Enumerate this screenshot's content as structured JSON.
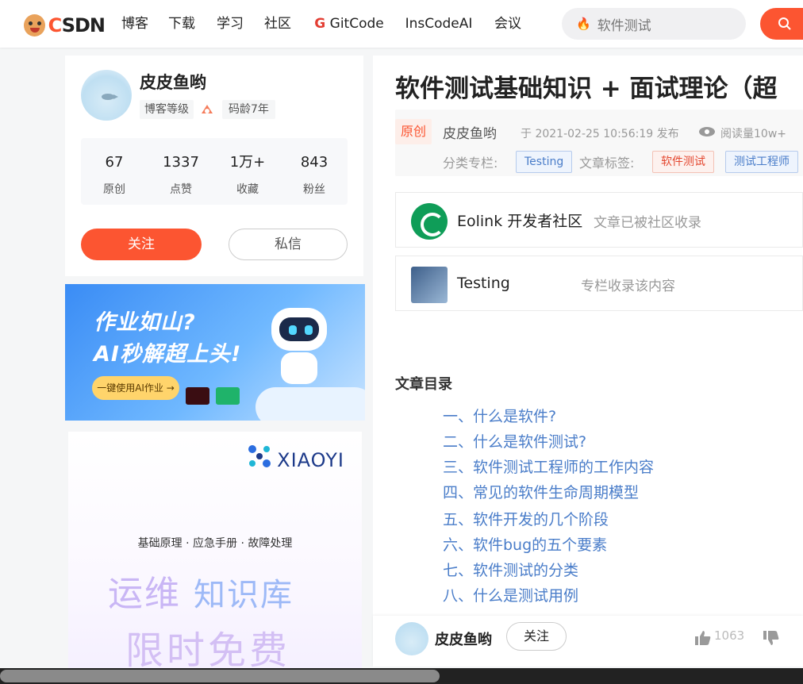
{
  "nav": {
    "brand": "CSDN",
    "items": [
      {
        "label": "博客"
      },
      {
        "label": "下载"
      },
      {
        "label": "学习"
      },
      {
        "label": "社区"
      },
      {
        "label": "GitCode"
      },
      {
        "label": "InsCodeAI"
      },
      {
        "label": "会议"
      }
    ],
    "search_placeholder": "软件测试",
    "accent_color": "#fc5531"
  },
  "profile": {
    "name": "皮皮鱼哟",
    "level_label": "博客等级",
    "code_age": "码龄7年",
    "stats": [
      {
        "value": "67",
        "label": "原创"
      },
      {
        "value": "1337",
        "label": "点赞"
      },
      {
        "value": "1万+",
        "label": "收藏"
      },
      {
        "value": "843",
        "label": "粉丝"
      }
    ],
    "follow_label": "关注",
    "message_label": "私信"
  },
  "ad1": {
    "line1": "作业如山?",
    "line2": "AI秒解超上头!",
    "cta": "一键使用AI作业 →"
  },
  "ad2": {
    "brand": "XIAOYI",
    "subtitle": "基础原理 · 应急手册 · 故障处理",
    "line1a": "运维",
    "line1b": "知识库",
    "line2": "限时免费"
  },
  "article": {
    "title": "软件测试基础知识 + 面试理论（超",
    "original_tag": "原创",
    "author": "皮皮鱼哟",
    "published": "于 2021-02-25 10:56:19 发布",
    "views": "阅读量10w+",
    "category_label": "分类专栏:",
    "category": "Testing",
    "tags_label": "文章标签:",
    "tags": [
      "软件测试",
      "测试工程师"
    ],
    "collections": [
      {
        "title": "Eolink 开发者社区",
        "note": "文章已被社区收录"
      },
      {
        "title": "Testing",
        "note": "专栏收录该内容"
      }
    ],
    "toc_title": "文章目录",
    "toc": [
      "一、什么是软件?",
      "二、什么是软件测试?",
      "三、软件测试工程师的工作内容",
      "四、常见的软件生命周期模型",
      "五、软件开发的几个阶段",
      "六、软件bug的五个要素",
      "七、软件测试的分类",
      "八、什么是测试用例"
    ]
  },
  "bottom": {
    "name": "皮皮鱼哟",
    "follow_label": "关注",
    "like_count": "1063"
  }
}
